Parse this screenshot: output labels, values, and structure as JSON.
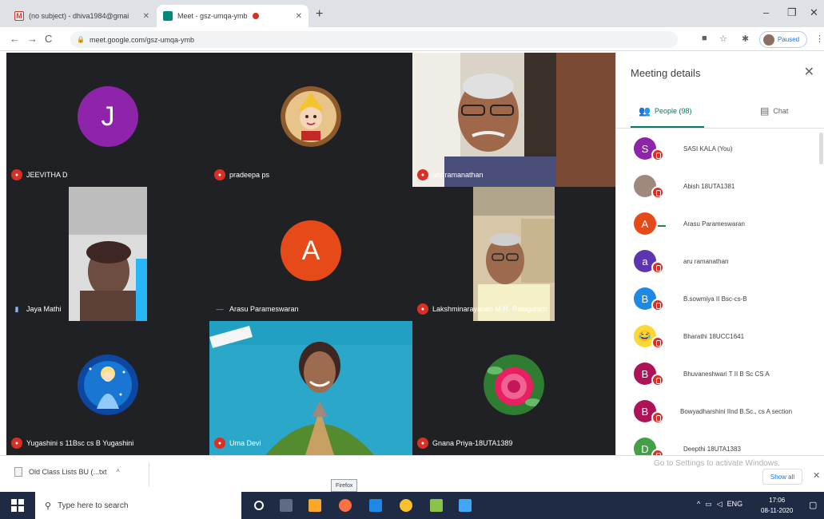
{
  "browser": {
    "tabs": [
      {
        "title": "(no subject) - dhiva1984@gmai"
      },
      {
        "title": "Meet - gsz-umqa-ymb"
      }
    ],
    "new_tab": "+",
    "url": "meet.google.com/gsz-umqa-ymb",
    "profile_label": "Paused",
    "window_controls": {
      "minimize": "–",
      "restore": "❐",
      "close": "✕"
    }
  },
  "tiles": [
    {
      "name": "JEEVITHA D",
      "type": "letter",
      "letter": "J",
      "color": "#8e24aa",
      "mic": "off"
    },
    {
      "name": "pradeepa ps",
      "type": "image",
      "image": "deity-portrait",
      "mic": "off"
    },
    {
      "name": "aru ramanathan",
      "type": "video",
      "mic": "off"
    },
    {
      "name": "Jaya Mathi",
      "type": "video",
      "mic": "on"
    },
    {
      "name": "Arasu Parameswaran",
      "type": "letter",
      "letter": "A",
      "color": "#e64a19",
      "mic": "on"
    },
    {
      "name": "Lakshminarayanan M.R. Rasiguram",
      "type": "video",
      "mic": "off"
    },
    {
      "name": "Yugashini s 11Bsc cs B Yugashini",
      "type": "image",
      "image": "cinderella",
      "mic": "off"
    },
    {
      "name": "Uma Devi",
      "type": "video",
      "mic": "off"
    },
    {
      "name": "Gnana Priya-18UTA1389",
      "type": "image",
      "image": "pink-rose",
      "mic": "off"
    }
  ],
  "panel": {
    "title": "Meeting details",
    "close": "✕",
    "people_tab": "People (98)",
    "chat_tab": "Chat",
    "people": [
      {
        "name": "SASI KALA (You)",
        "letter": "S",
        "color": "#8e24aa",
        "mic": "off"
      },
      {
        "name": "Abish 18UTA1381",
        "letter": "",
        "color": "#a1887f",
        "mic": "off"
      },
      {
        "name": "Arasu Parameswaran",
        "letter": "A",
        "color": "#e64a19",
        "mic": "on"
      },
      {
        "name": "aru ramanathan",
        "letter": "a",
        "color": "#5e35b1",
        "mic": "off"
      },
      {
        "name": "B.sowmiya II Bsc-cs-B",
        "letter": "B",
        "color": "#1e88e5",
        "mic": "off"
      },
      {
        "name": "Bharathi 18UCC1641",
        "letter": "",
        "color": "#fdd835",
        "mic": "off"
      },
      {
        "name": "Bhuvaneshwari T II B Sc CS A",
        "letter": "B",
        "color": "#ad1457",
        "mic": "off"
      },
      {
        "name": "Bowyadharshini IInd B.Sc., cs A section",
        "letter": "B",
        "color": "#ad1457",
        "mic": "off"
      },
      {
        "name": "Deepthi 18UTA1383",
        "letter": "D",
        "color": "#43a047",
        "mic": "off"
      }
    ]
  },
  "downloads": {
    "file": "Old Class Lists BU (...txt",
    "chevron": "^",
    "show_all": "Show all",
    "close": "✕",
    "watermark": "Go to Settings to activate Windows."
  },
  "tooltip": "Firefox",
  "taskbar": {
    "search_placeholder": "Type here to search",
    "tray_text": "ENG",
    "time": "17:06",
    "date": "08-11-2020"
  }
}
